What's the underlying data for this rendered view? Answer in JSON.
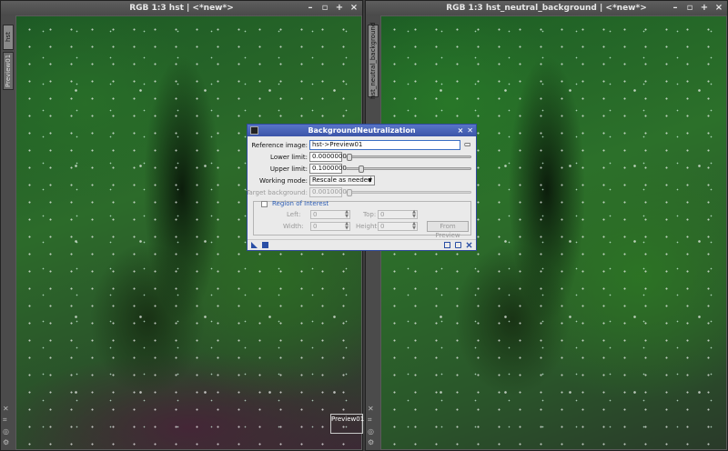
{
  "left_window": {
    "title": "RGB 1:3 hst | <*new*>",
    "tabs": [
      "hst",
      "Preview01"
    ],
    "preview_label": "Preview01",
    "controls": [
      "–",
      "▫",
      "+",
      "×"
    ]
  },
  "right_window": {
    "title": "RGB 1:3 hst_neutral_background | <*new*>",
    "tabs": [
      "hst_neutral_background"
    ],
    "controls": [
      "–",
      "▫",
      "+",
      "×"
    ]
  },
  "dialog": {
    "title": "BackgroundNeutralization",
    "reference_label": "Reference image:",
    "reference_value": "hst->Preview01",
    "lower_label": "Lower limit:",
    "lower_value": "0.0000000",
    "lower_level": 0.0,
    "upper_label": "Upper limit:",
    "upper_value": "0.1000000",
    "upper_level": 0.1,
    "working_label": "Working mode:",
    "working_value": "Rescale as needed",
    "target_label": "Target background:",
    "target_value": "0.0010000",
    "target_level": 0.001,
    "roi_title": "Region of Interest",
    "left_label": "Left:",
    "left_value": "0",
    "top_label": "Top:",
    "top_value": "0",
    "width_label": "Width:",
    "width_value": "0",
    "height_label": "Height:",
    "height_value": "0",
    "from_preview_label": "From Preview"
  },
  "colors": {
    "dialog_title_bg": "#3c55a8",
    "roi_accent": "#2a5bb3"
  }
}
